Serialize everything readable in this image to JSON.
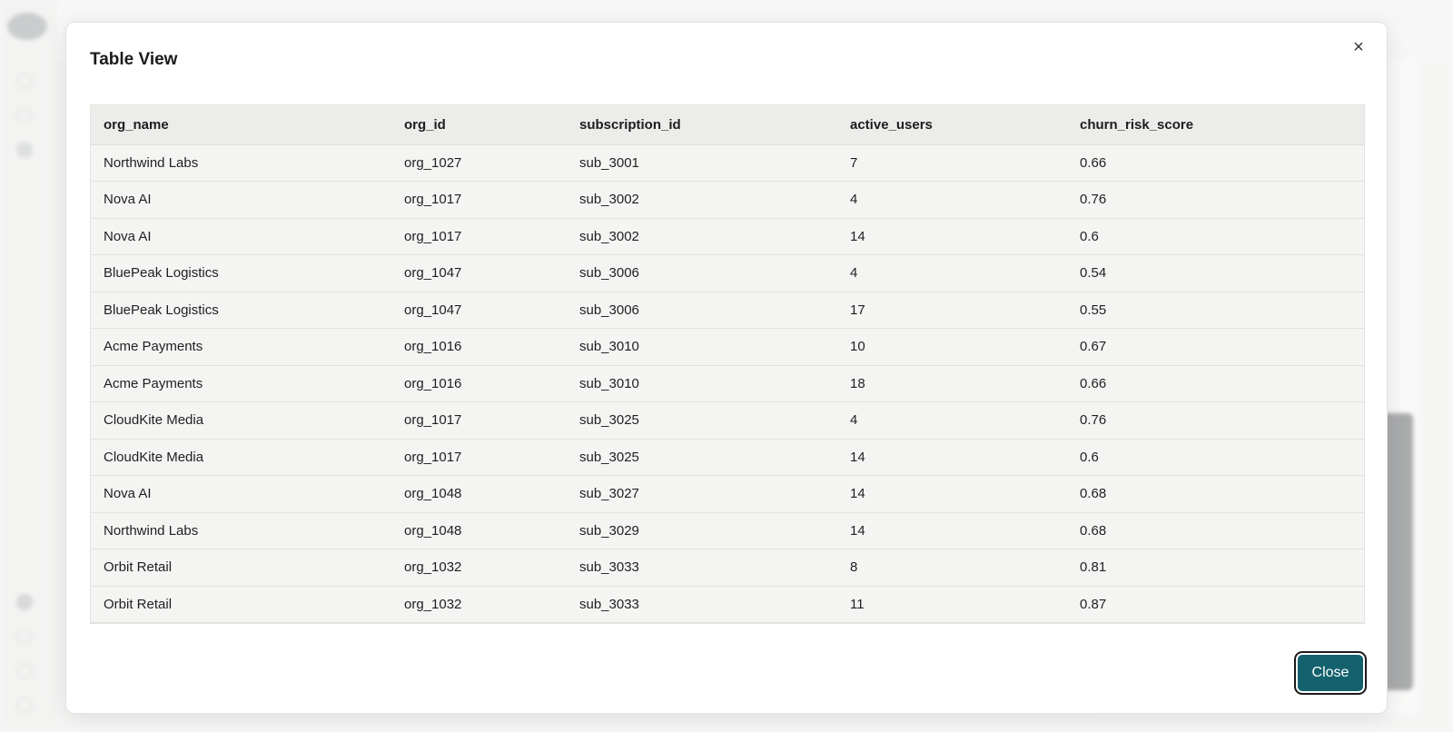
{
  "modal": {
    "title": "Table View",
    "close_icon_glyph": "×",
    "close_button_label": "Close"
  },
  "table": {
    "columns": [
      "org_name",
      "org_id",
      "subscription_id",
      "active_users",
      "churn_risk_score"
    ],
    "rows": [
      [
        "Northwind Labs",
        "org_1027",
        "sub_3001",
        "7",
        "0.66"
      ],
      [
        "Nova AI",
        "org_1017",
        "sub_3002",
        "4",
        "0.76"
      ],
      [
        "Nova AI",
        "org_1017",
        "sub_3002",
        "14",
        "0.6"
      ],
      [
        "BluePeak Logistics",
        "org_1047",
        "sub_3006",
        "4",
        "0.54"
      ],
      [
        "BluePeak Logistics",
        "org_1047",
        "sub_3006",
        "17",
        "0.55"
      ],
      [
        "Acme Payments",
        "org_1016",
        "sub_3010",
        "10",
        "0.67"
      ],
      [
        "Acme Payments",
        "org_1016",
        "sub_3010",
        "18",
        "0.66"
      ],
      [
        "CloudKite Media",
        "org_1017",
        "sub_3025",
        "4",
        "0.76"
      ],
      [
        "CloudKite Media",
        "org_1017",
        "sub_3025",
        "14",
        "0.6"
      ],
      [
        "Nova AI",
        "org_1048",
        "sub_3027",
        "14",
        "0.68"
      ],
      [
        "Northwind Labs",
        "org_1048",
        "sub_3029",
        "14",
        "0.68"
      ],
      [
        "Orbit Retail",
        "org_1032",
        "sub_3033",
        "8",
        "0.81"
      ],
      [
        "Orbit Retail",
        "org_1032",
        "sub_3033",
        "11",
        "0.87"
      ]
    ]
  },
  "colors": {
    "primary_button": "#14616e",
    "table_header_bg": "#ececea",
    "table_row_bg": "#f4f4f3"
  }
}
